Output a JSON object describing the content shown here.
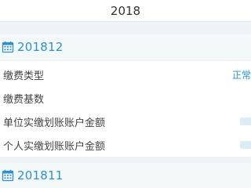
{
  "year_selector": {
    "value": "2018"
  },
  "months": [
    {
      "label": "201812",
      "rows": [
        {
          "label": "缴费类型",
          "value": "正常"
        },
        {
          "label": "缴费基数",
          "value": ""
        },
        {
          "label": "单位实缴划账账户金额",
          "value": ""
        },
        {
          "label": "个人实缴划账账户金额",
          "value": ""
        }
      ]
    },
    {
      "label": "201811"
    }
  ],
  "colors": {
    "accent": "#2e91cf",
    "background": "#eef3f5",
    "row_background": "#ffffff"
  },
  "icons": {
    "month_header": "calendar-icon"
  }
}
